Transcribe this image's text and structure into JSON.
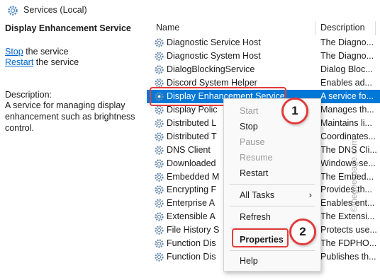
{
  "window": {
    "title": "Services (Local)"
  },
  "left_pane": {
    "service_name": "Display Enhancement Service",
    "stop_link": "Stop",
    "stop_suffix": " the service",
    "restart_link": "Restart",
    "restart_suffix": " the service",
    "description_label": "Description:",
    "description_text": "A service for managing display enhancement such as brightness control."
  },
  "columns": {
    "name": "Name",
    "description": "Description"
  },
  "rows": [
    {
      "name": "Diagnostic Service Host",
      "desc": "The Diagno..."
    },
    {
      "name": "Diagnostic System Host",
      "desc": "The Diagno..."
    },
    {
      "name": "DialogBlockingService",
      "desc": "Dialog Bloc..."
    },
    {
      "name": "Discord System Helper",
      "desc": "Enables ad..."
    },
    {
      "name": "Display Enhancement Service",
      "desc": "A service fo..."
    },
    {
      "name": "Display Polic",
      "desc": "Manages th..."
    },
    {
      "name": "Distributed L",
      "desc": "Maintains li..."
    },
    {
      "name": "Distributed T",
      "desc": "Coordinates..."
    },
    {
      "name": "DNS Client",
      "desc": "The DNS Cli..."
    },
    {
      "name": "Downloaded",
      "desc": "Windows se..."
    },
    {
      "name": "Embedded M",
      "desc": "The Embed..."
    },
    {
      "name": "Encrypting F",
      "desc": "Provides th..."
    },
    {
      "name": "Enterprise A",
      "desc": "Enables ent..."
    },
    {
      "name": "Extensible A",
      "desc": "The Extensi..."
    },
    {
      "name": "File History S",
      "desc": "Protects use..."
    },
    {
      "name": "Function Dis",
      "desc": "The FDPHO..."
    },
    {
      "name": "Function Dis",
      "desc": "Publishes th..."
    }
  ],
  "context_menu": {
    "start": "Start",
    "stop": "Stop",
    "pause": "Pause",
    "resume": "Resume",
    "restart": "Restart",
    "all_tasks": "All Tasks",
    "all_tasks_arrow": "›",
    "refresh": "Refresh",
    "properties": "Properties",
    "help": "Help"
  },
  "badges": {
    "one": "1",
    "two": "2"
  },
  "watermark": "©thegeekpage.com",
  "colors": {
    "selection": "#0078d7",
    "annotation": "#e23b3b",
    "link": "#0066cc"
  }
}
